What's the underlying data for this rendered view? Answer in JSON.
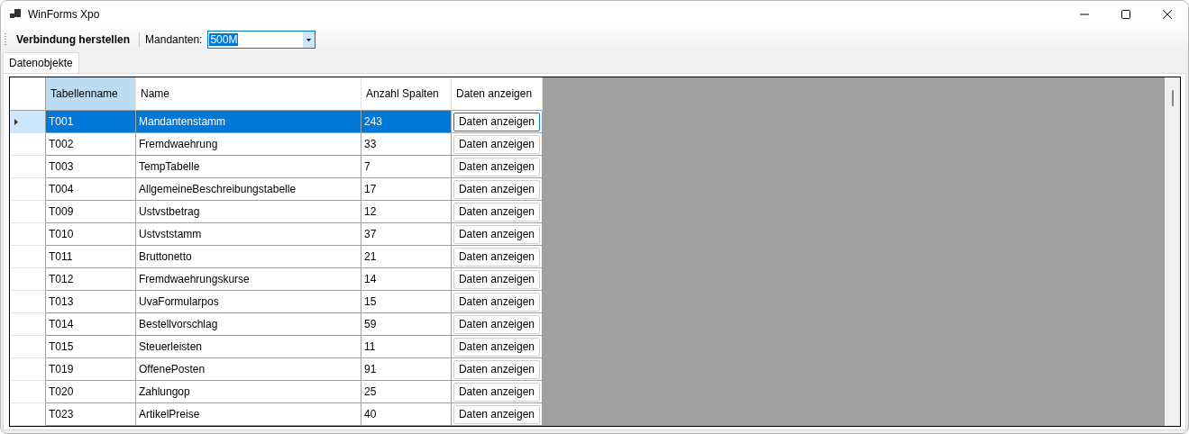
{
  "window": {
    "title": "WinForms Xpo"
  },
  "toolbar": {
    "connect_button": "Verbindung herstellen",
    "client_label": "Mandanten:",
    "client_value": "500M"
  },
  "tabs": [
    {
      "label": "Datenobjekte",
      "selected": true
    }
  ],
  "grid": {
    "columns": [
      {
        "label": "Tabellenname",
        "selected": true
      },
      {
        "label": "Name",
        "selected": false
      },
      {
        "label": "Anzahl Spalten",
        "selected": false
      },
      {
        "label": "Daten anzeigen",
        "selected": false
      }
    ],
    "rows": [
      {
        "table": "T001",
        "name": "Mandantenstamm",
        "count": "243",
        "action": "Daten anzeigen",
        "selected": true
      },
      {
        "table": "T002",
        "name": "Fremdwaehrung",
        "count": "33",
        "action": "Daten anzeigen",
        "selected": false
      },
      {
        "table": "T003",
        "name": "TempTabelle",
        "count": "7",
        "action": "Daten anzeigen",
        "selected": false
      },
      {
        "table": "T004",
        "name": "AllgemeineBeschreibungstabelle",
        "count": "17",
        "action": "Daten anzeigen",
        "selected": false
      },
      {
        "table": "T009",
        "name": "Ustvstbetrag",
        "count": "12",
        "action": "Daten anzeigen",
        "selected": false
      },
      {
        "table": "T010",
        "name": "Ustvststamm",
        "count": "37",
        "action": "Daten anzeigen",
        "selected": false
      },
      {
        "table": "T011",
        "name": "Bruttonetto",
        "count": "21",
        "action": "Daten anzeigen",
        "selected": false
      },
      {
        "table": "T012",
        "name": "Fremdwaehrungskurse",
        "count": "14",
        "action": "Daten anzeigen",
        "selected": false
      },
      {
        "table": "T013",
        "name": "UvaFormularpos",
        "count": "15",
        "action": "Daten anzeigen",
        "selected": false
      },
      {
        "table": "T014",
        "name": "Bestellvorschlag",
        "count": "59",
        "action": "Daten anzeigen",
        "selected": false
      },
      {
        "table": "T015",
        "name": "Steuerleisten",
        "count": "11",
        "action": "Daten anzeigen",
        "selected": false
      },
      {
        "table": "T019",
        "name": "OffenePosten",
        "count": "91",
        "action": "Daten anzeigen",
        "selected": false
      },
      {
        "table": "T020",
        "name": "Zahlungop",
        "count": "25",
        "action": "Daten anzeigen",
        "selected": false
      },
      {
        "table": "T023",
        "name": "ArtikelPreise",
        "count": "40",
        "action": "Daten anzeigen",
        "selected": false
      }
    ]
  }
}
